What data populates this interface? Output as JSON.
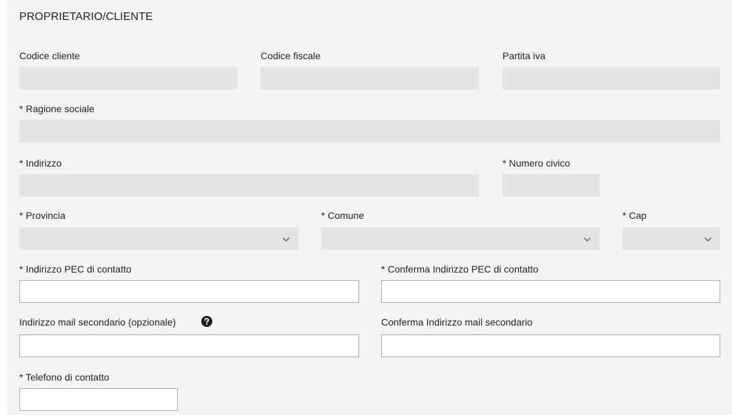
{
  "section": {
    "title": "PROPRIETARIO/CLIENTE"
  },
  "fields": {
    "codice_cliente": {
      "label": "Codice cliente",
      "value": ""
    },
    "codice_fiscale": {
      "label": "Codice fiscale",
      "value": ""
    },
    "partita_iva": {
      "label": "Partita iva",
      "value": ""
    },
    "ragione_sociale": {
      "label": "* Ragione sociale",
      "value": ""
    },
    "indirizzo": {
      "label": "* Indirizzo",
      "value": ""
    },
    "numero_civico": {
      "label": "* Numero civico",
      "value": ""
    },
    "provincia": {
      "label": "* Provincia",
      "selected": ""
    },
    "comune": {
      "label": "* Comune",
      "selected": ""
    },
    "cap": {
      "label": "* Cap",
      "selected": ""
    },
    "pec": {
      "label": "* Indirizzo PEC di contatto",
      "value": ""
    },
    "pec_conferma": {
      "label": "* Conferma Indirizzo PEC di contatto",
      "value": ""
    },
    "mail_secondaria": {
      "label": "Indirizzo mail secondario (opzionale)",
      "value": ""
    },
    "mail_secondaria_conferma": {
      "label": "Conferma Indirizzo mail secondario",
      "value": ""
    },
    "telefono": {
      "label": "* Telefono di contatto",
      "value": ""
    }
  },
  "icons": {
    "help": "question-circle-icon",
    "dropdown": "chevron-down-icon"
  },
  "colors": {
    "panel_bg": "#f4f4f4",
    "readonly_bg": "#e4e4e4",
    "input_border": "#a9a9a9"
  }
}
